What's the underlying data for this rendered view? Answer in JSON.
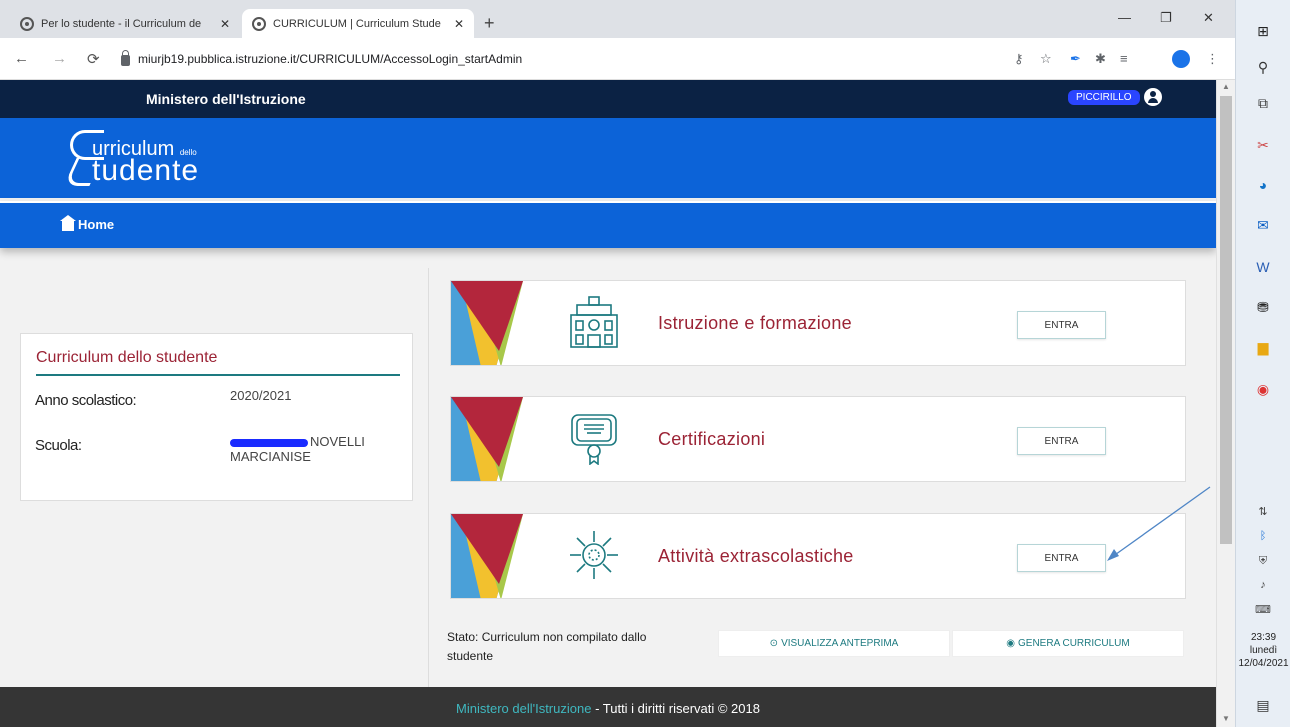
{
  "browser": {
    "tabs": [
      {
        "title": "Per lo studente - il Curriculum de",
        "close": "✕"
      },
      {
        "title": "CURRICULUM | Curriculum Stude",
        "close": "✕"
      }
    ],
    "new_tab": "+",
    "window_controls": {
      "minimize": "—",
      "restore": "❐",
      "close": "✕"
    },
    "nav": {
      "back": "←",
      "forward": "→",
      "reload": "⟳"
    },
    "url": "miurjb19.pubblica.istruzione.it/CURRICULUM/AccessoLogin_startAdmin"
  },
  "header": {
    "ministry": "Ministero dell'Istruzione",
    "user_name": "PICCIRILLO",
    "logo_line1": "urriculum",
    "logo_small": "dello",
    "logo_line2": "tudente"
  },
  "nav": {
    "home": "Home"
  },
  "info_card": {
    "title": "Curriculum dello studente",
    "anno_label": "Anno scolastico:",
    "anno_value": "2020/2021",
    "scuola_label": "Scuola:",
    "scuola_value_1": "NOVELLI",
    "scuola_value_2": "MARCIANISE"
  },
  "sections": [
    {
      "title": "Istruzione e formazione",
      "button": "ENTRA"
    },
    {
      "title": "Certificazioni",
      "button": "ENTRA"
    },
    {
      "title": "Attività extrascolastiche",
      "button": "ENTRA"
    }
  ],
  "status": "Stato: Curriculum non compilato dallo studente",
  "actions": {
    "preview": "VISUALIZZA ANTEPRIMA",
    "generate": "GENERA CURRICULUM"
  },
  "footer": {
    "link": "Ministero dell'Istruzione",
    "rest": " - Tutti i diritti riservati © 2018"
  },
  "clock": {
    "time": "23:39",
    "day": "lunedì",
    "date": "12/04/2021"
  },
  "colors": {
    "topbar": "#0b2244",
    "brand_blue": "#0c63d8",
    "accent_red": "#9b2335",
    "teal": "#1d7a80",
    "footer": "#353535"
  }
}
